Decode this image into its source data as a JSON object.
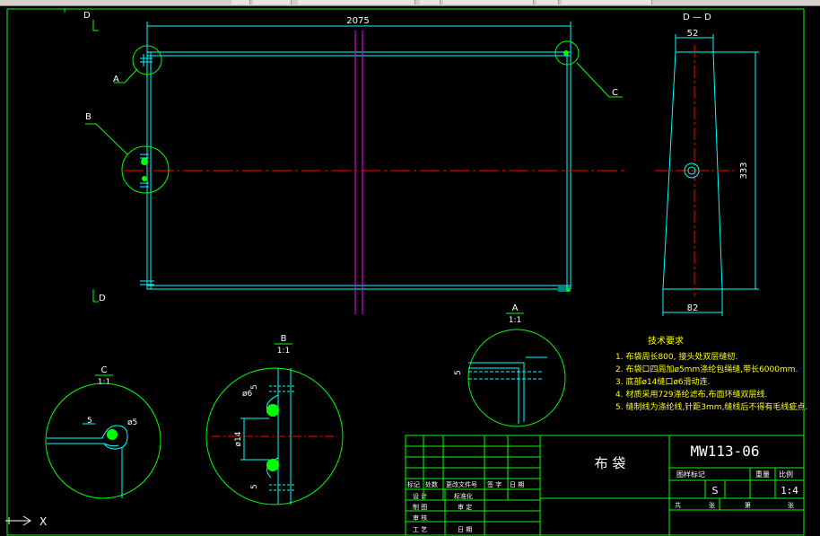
{
  "drawing": {
    "overall_width": "2075",
    "section_marker": "D",
    "section_title": "D — D",
    "section_dims": {
      "top": "52",
      "height": "333",
      "bottom": "82"
    },
    "callouts": {
      "a": "A",
      "b": "B",
      "c": "C"
    }
  },
  "details": {
    "c": {
      "label": "C",
      "scale": "1:1",
      "dim1": "5",
      "dim2": "ø5"
    },
    "b": {
      "label": "B",
      "scale": "1:1",
      "dim_top": "5",
      "dim_hole": "ø6",
      "dim_span": "ø14",
      "dim_bottom": "5"
    },
    "a": {
      "label": "A",
      "scale": "1:1",
      "dim": "5"
    }
  },
  "notes": {
    "title": "技术要求",
    "items": [
      "1. 布袋周长800, 接头处双层缝纫.",
      "2. 布袋口四周加ø5mm涤纶包绳缝,带长6000mm.",
      "3. 底部ø14缝口ø6滑动连.",
      "4. 材质采用729涤纶滤布,布面环缝双层线.",
      "5. 缝制线为涤纶线,针距3mm,缝线后不得有毛线疵点."
    ]
  },
  "title_block": {
    "drawing_number": "MW113-06",
    "part_name": "布 袋",
    "stage_label": "图样标记",
    "weight_label": "重量",
    "scale_label": "比例",
    "stage_value": "S",
    "scale_value": "1:4",
    "sheet_total": "共",
    "sheet_unit": "张",
    "sheet_no": "第",
    "sheet_unit2": "张",
    "rev_headers": [
      "标记",
      "处数",
      "更改文件号",
      "签 字",
      "日 期"
    ],
    "roles": [
      "设 计",
      "制 图",
      "审 核",
      "工 艺"
    ],
    "roles_right": [
      "标准化",
      "审 定",
      "",
      "日 期"
    ]
  },
  "ucs": {
    "x_label": "X"
  },
  "colors": {
    "frame": "#00ff00",
    "outline": "#00ffff",
    "center": "#ff0000",
    "magenta": "#ff00ff",
    "text": "#ffffff",
    "notes": "#ffff00"
  }
}
